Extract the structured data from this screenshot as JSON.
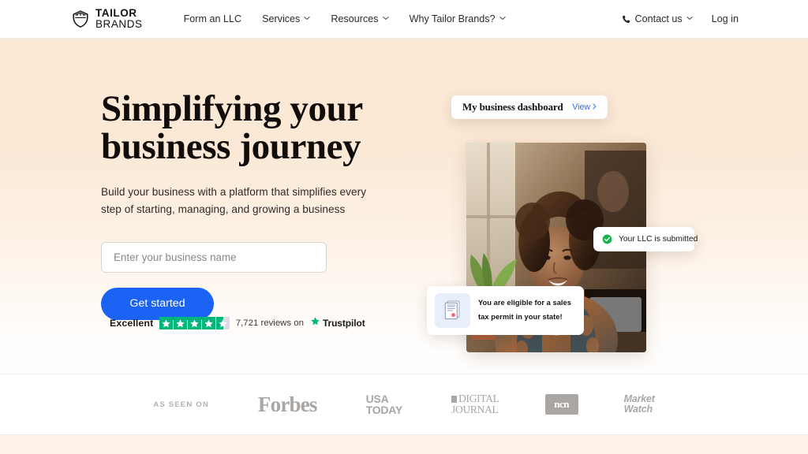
{
  "nav": {
    "logo": {
      "line1": "TAILOR",
      "line2": "BRANDS",
      "icon": "tailor-brands-logo-icon"
    },
    "links": [
      {
        "label": "Form an LLC",
        "has_chevron": false
      },
      {
        "label": "Services",
        "has_chevron": true
      },
      {
        "label": "Resources",
        "has_chevron": true
      },
      {
        "label": "Why Tailor Brands?",
        "has_chevron": true
      }
    ],
    "contact": {
      "label": "Contact us",
      "icon": "phone-icon",
      "has_chevron": true
    },
    "login": {
      "label": "Log in"
    }
  },
  "hero": {
    "headline_line1": "Simplifying your",
    "headline_line2": "business journey",
    "subhead": "Build your business with a platform that simplifies every step of starting, managing, and growing a business",
    "input_placeholder": "Enter your business name",
    "input_value": "",
    "cta_label": "Get started"
  },
  "trustpilot": {
    "rating_word": "Excellent",
    "stars_total": 5,
    "stars_filled": 4,
    "stars_half": 1,
    "reviews_text": "7,721 reviews on",
    "brand": "Trustpilot",
    "star_color": "#00b67a",
    "star_empty_color": "#dcdce6"
  },
  "visual": {
    "dashboard_card": {
      "title": "My business dashboard",
      "view_label": "View",
      "view_color": "#2b6df5"
    },
    "llc_card": {
      "text": "Your LLC is submitted",
      "icon": "green-check-circle-icon",
      "icon_color": "#1db954"
    },
    "tax_card": {
      "title_line1": "You are eligible for a sales",
      "title_line2": "tax permit in your state!",
      "icon": "certificate-document-icon"
    },
    "photo_alt": "smiling-woman-at-desk-photo"
  },
  "press": {
    "as_seen_on": "AS SEEN ON",
    "logos": [
      {
        "name": "forbes-logo",
        "text": "Forbes"
      },
      {
        "name": "usa-today-logo",
        "line1": "USA",
        "line2": "TODAY"
      },
      {
        "name": "digital-journal-logo",
        "line1": "DIGITAL",
        "line2": "JOURNAL"
      },
      {
        "name": "ncn-logo",
        "text": "ncn"
      },
      {
        "name": "marketwatch-logo",
        "line1": "Market",
        "line2": "Watch"
      }
    ]
  },
  "theme": {
    "hero_bg_top": "#fbe8d5",
    "hero_bg_bottom": "#fffdfb",
    "accent_blue": "#1a63f5",
    "text_dark": "#100d0b"
  }
}
